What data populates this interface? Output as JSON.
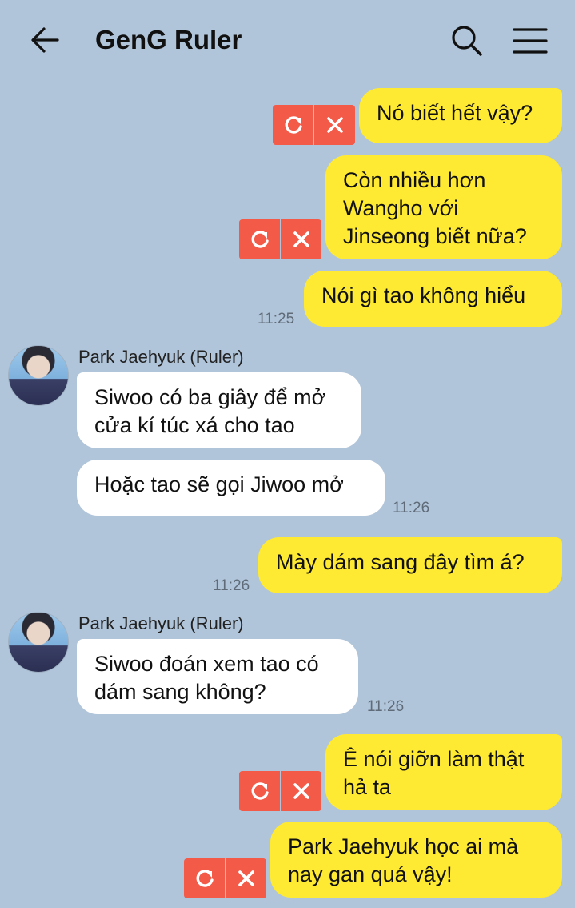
{
  "header": {
    "title": "GenG Ruler",
    "back_icon": "arrow-left-icon",
    "search_icon": "search-icon",
    "menu_icon": "hamburger-menu-icon"
  },
  "colors": {
    "background": "#b1c5da",
    "my_bubble": "#fee933",
    "their_bubble": "#ffffff",
    "failed_action": "#f35a48"
  },
  "messages": [
    {
      "side": "me",
      "text": "Nó biết hết vậy?",
      "failed": true
    },
    {
      "side": "me",
      "text": "Còn nhiều hơn\nWangho với\nJinseong biết nữa?",
      "failed": true
    },
    {
      "side": "me",
      "text": "Nói gì tao không hiểu",
      "time": "11:25"
    },
    {
      "side": "them",
      "sender": "Park Jaehyuk (Ruler)",
      "text": "Siwoo có ba giây để mở\ncửa kí túc xá cho tao"
    },
    {
      "side": "them",
      "text": "Hoặc tao sẽ gọi Jiwoo mở",
      "time": "11:26"
    },
    {
      "side": "me",
      "text": "Mày dám sang đây tìm á?",
      "time": "11:26"
    },
    {
      "side": "them",
      "sender": "Park Jaehyuk (Ruler)",
      "text": "Siwoo đoán xem tao có\ndám sang không?",
      "time": "11:26"
    },
    {
      "side": "me",
      "text": "Ê nói giỡn làm thật\nhả ta",
      "failed": true
    },
    {
      "side": "me",
      "text": "Park Jaehyuk học ai mà\nnay gan quá vậy!",
      "failed": true
    }
  ]
}
